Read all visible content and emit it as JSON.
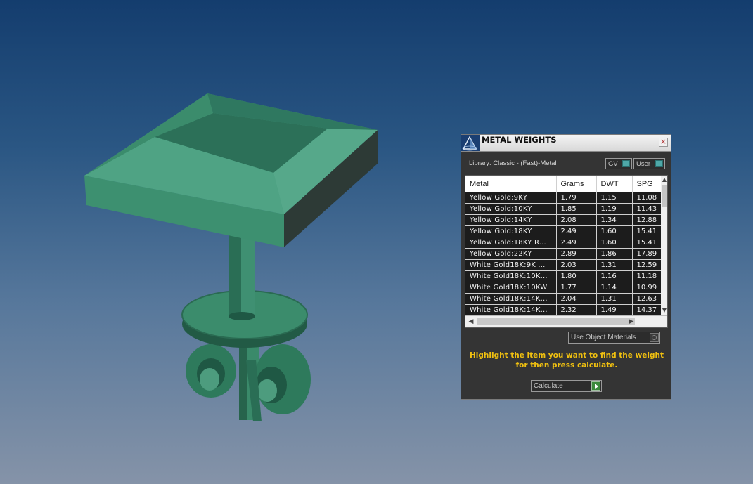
{
  "panel": {
    "title": "METAL WEIGHTS",
    "close_glyph": "×",
    "library_label": "Library: Classic - (Fast)-Metal",
    "toggles": {
      "gv_label": "GV",
      "user_label": "User"
    },
    "icons": {
      "logo": "pyramid-logo-icon",
      "close": "close-icon",
      "toggle_knob": "toggle-knob-icon",
      "radio": "radio-icon",
      "go": "play-arrow-icon"
    }
  },
  "table": {
    "headers": {
      "metal": "Metal",
      "grams": "Grams",
      "dwt": "DWT",
      "spg": "SPG"
    },
    "rows": [
      {
        "metal": "Yellow Gold:9KY",
        "grams": "1.79",
        "dwt": "1.15",
        "spg": "11.08"
      },
      {
        "metal": "Yellow Gold:10KY",
        "grams": "1.85",
        "dwt": "1.19",
        "spg": "11.43"
      },
      {
        "metal": "Yellow Gold:14KY",
        "grams": "2.08",
        "dwt": "1.34",
        "spg": "12.88"
      },
      {
        "metal": "Yellow Gold:18KY",
        "grams": "2.49",
        "dwt": "1.60",
        "spg": "15.41"
      },
      {
        "metal": "Yellow Gold:18KY R...",
        "grams": "2.49",
        "dwt": "1.60",
        "spg": "15.41"
      },
      {
        "metal": "Yellow Gold:22KY",
        "grams": "2.89",
        "dwt": "1.86",
        "spg": "17.89"
      },
      {
        "metal": "White Gold18K:9K ...",
        "grams": "2.03",
        "dwt": "1.31",
        "spg": "12.59"
      },
      {
        "metal": "White Gold18K:10K...",
        "grams": "1.80",
        "dwt": "1.16",
        "spg": "11.18"
      },
      {
        "metal": "White Gold18K:10KW",
        "grams": "1.77",
        "dwt": "1.14",
        "spg": "10.99"
      },
      {
        "metal": "White Gold18K:14K...",
        "grams": "2.04",
        "dwt": "1.31",
        "spg": "12.63"
      },
      {
        "metal": "White Gold18K:14K...",
        "grams": "2.32",
        "dwt": "1.49",
        "spg": "14.37"
      }
    ]
  },
  "use_object_materials_label": "Use Object Materials",
  "instruction": "Highlight the item you want to find the weight for then press calculate.",
  "calculate_label": "Calculate",
  "colors": {
    "accent_text": "#f0c010",
    "panel_bg": "#343434",
    "model_green": "#3a8a6a"
  }
}
